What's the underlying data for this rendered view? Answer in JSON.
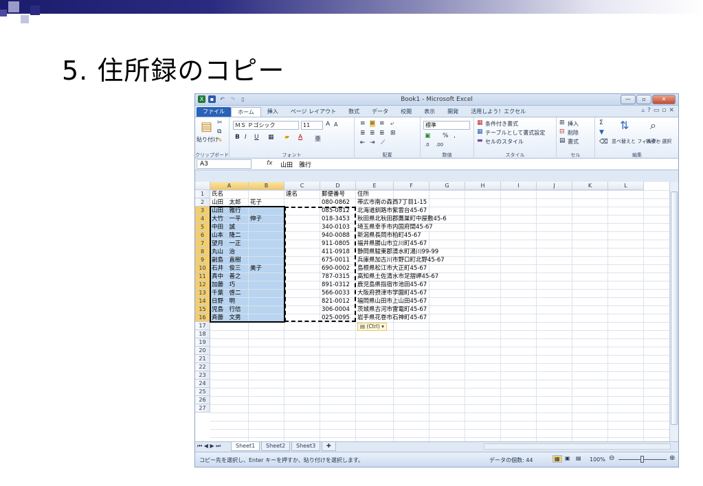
{
  "slide": {
    "title": "5. 住所録のコピー"
  },
  "window": {
    "title": "Book1 - Microsoft Excel"
  },
  "tabs": [
    "ファイル",
    "ホーム",
    "挿入",
    "ページ レイアウト",
    "数式",
    "データ",
    "校閲",
    "表示",
    "開発",
    "活用しよう！エクセル"
  ],
  "ribbon": {
    "paste": "貼り付け",
    "font_name": "ＭＳ Ｐゴシック",
    "font_size": "11",
    "number_format": "標準",
    "cond_format": "条件付き書式",
    "table_format": "テーブルとして書式設定",
    "cell_style": "セルのスタイル",
    "insert": "挿入",
    "delete": "削除",
    "format": "書式",
    "sort_filter": "並べ替えと フィルター",
    "find_select": "検索と 選択",
    "groups": [
      "クリップボード",
      "フォント",
      "配置",
      "数値",
      "スタイル",
      "セル",
      "編集"
    ]
  },
  "formula_bar": {
    "name_box": "A3",
    "fx": "fx",
    "value": "山田　雅行"
  },
  "columns": [
    "A",
    "B",
    "C",
    "D",
    "E",
    "F",
    "G",
    "H",
    "I",
    "J",
    "K",
    "L"
  ],
  "rows": [
    "1",
    "2",
    "3",
    "4",
    "5",
    "6",
    "7",
    "8",
    "9",
    "10",
    "11",
    "12",
    "13",
    "14",
    "15",
    "16",
    "17",
    "18",
    "19",
    "20",
    "21",
    "22",
    "23",
    "24",
    "25",
    "26",
    "27"
  ],
  "table": [
    [
      "氏名",
      "",
      "連名",
      "郵便番号",
      "住所"
    ],
    [
      "山田　太郎",
      "花子",
      "",
      "080-0862",
      "帯広市南の森西7丁目1-15"
    ],
    [
      "山田　雅行",
      "",
      "",
      "085-0812",
      "北海道釧路市紫雲台45-67"
    ],
    [
      "大竹　一平",
      "伸子",
      "",
      "018-3453",
      "秋田県北秋田郡鷹巣町中屋敷45-6"
    ],
    [
      "中田　誠",
      "",
      "",
      "340-0103",
      "埼玉県幸手市内国府間45-67"
    ],
    [
      "山本　隆二",
      "",
      "",
      "940-0088",
      "新潟県長岡市柏町45-67"
    ],
    [
      "望月　一正",
      "",
      "",
      "911-0805",
      "福井県勝山市立川町45-67"
    ],
    [
      "丸山　治",
      "",
      "",
      "411-0918",
      "静岡県駿東郡清水町湯川99-99"
    ],
    [
      "副島　直樹",
      "",
      "",
      "675-0011",
      "兵庫県加古川市野口町北野45-67"
    ],
    [
      "石井　俊三",
      "美子",
      "",
      "690-0002",
      "島根県松江市大正町45-67"
    ],
    [
      "真中　善之",
      "",
      "",
      "787-0315",
      "高知県土佐清水市足摺岬45-67"
    ],
    [
      "加藤　巧",
      "",
      "",
      "891-0312",
      "鹿児島県指宿市池田45-67"
    ],
    [
      "千葉　啓二",
      "",
      "",
      "566-0033",
      "大阪府摂津市学園町45-67"
    ],
    [
      "日野　明",
      "",
      "",
      "821-0012",
      "福岡県山田市上山田45-67"
    ],
    [
      "児島　行信",
      "",
      "",
      "306-0004",
      "茨城県古河市雷電町45-67"
    ],
    [
      "斉藤　文男",
      "",
      "",
      "025-0095",
      "岩手県花巻市石神町45-67"
    ]
  ],
  "paste_options": "(Ctrl)",
  "sheets": [
    "Sheet1",
    "Sheet2",
    "Sheet3"
  ],
  "status": {
    "message": "コピー先を選択し、Enter キーを押すか、貼り付けを選択します。",
    "count": "データの個数: 44",
    "zoom": "100%"
  },
  "colors": {
    "selection": "#b8d4f0",
    "file_tab": "#2a62b8",
    "title_bar": "#1c1c6e"
  }
}
